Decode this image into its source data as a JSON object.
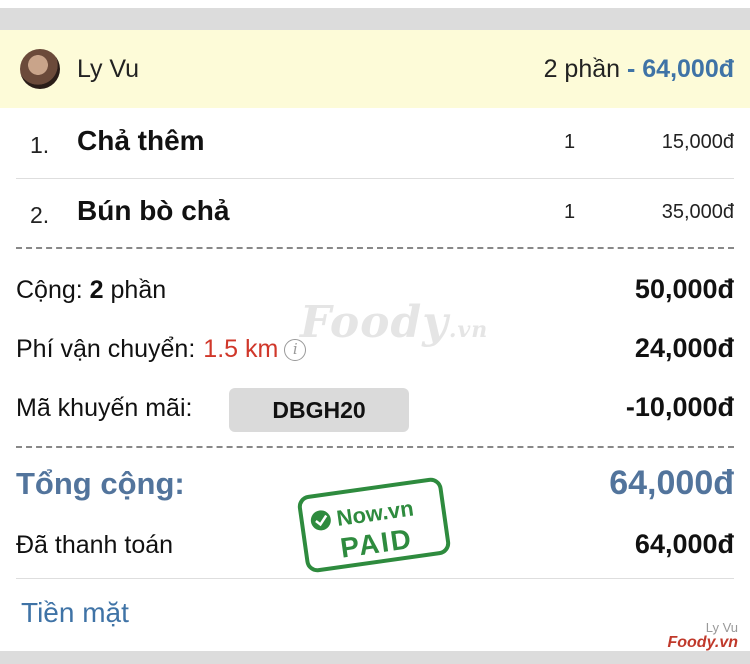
{
  "user": {
    "name": "Ly Vu",
    "portions": "2 phần",
    "total": "- 64,000đ"
  },
  "items": [
    {
      "index": "1.",
      "name": "Chả thêm",
      "qty": "1",
      "price": "15,000đ"
    },
    {
      "index": "2.",
      "name": "Bún bò chả",
      "qty": "1",
      "price": "35,000đ"
    }
  ],
  "summary": {
    "subtotal_label": "Cộng:",
    "subtotal_count": "2",
    "subtotal_unit": "phần",
    "subtotal_value": "50,000đ",
    "shipping_label": "Phí vận chuyển:",
    "shipping_distance": "1.5 km",
    "shipping_value": "24,000đ",
    "promo_label": "Mã khuyến mãi:",
    "promo_code": "DBGH20",
    "promo_value": "-10,000đ",
    "total_label": "Tổng cộng:",
    "total_value": "64,000đ",
    "paid_label": "Đã thanh toán",
    "paid_value": "64,000đ"
  },
  "payment_method": "Tiền mặt",
  "stamp": {
    "brand": "Now.vn",
    "text": "PAID"
  },
  "watermark": {
    "brand": "Foody",
    "suffix": ".vn"
  },
  "credit": {
    "user": "Ly Vu",
    "brand": "Foody.vn"
  },
  "colors": {
    "accent_blue": "#3f73a6",
    "total_blue": "#52749c",
    "distance_red": "#d0372a",
    "stamp_green": "#2e8b3e",
    "highlight_bg": "#fdfbd8"
  },
  "icons": {
    "info": "info-icon",
    "stamp_check": "check-circle-icon"
  }
}
